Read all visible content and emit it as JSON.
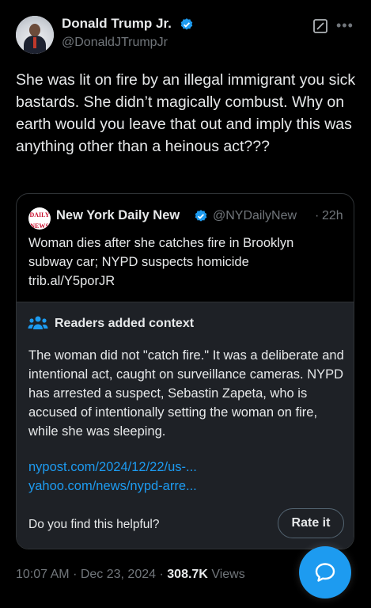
{
  "author": {
    "name": "Donald Trump Jr.",
    "handle": "@DonaldJTrumpJr",
    "verified": true
  },
  "icons": {
    "verified": "verified-badge-icon",
    "grok": "grok-icon",
    "more": "more-icon",
    "context": "people-icon",
    "reply": "reply-bubble-icon"
  },
  "colors": {
    "accent": "#1d9bf0",
    "background": "#000000",
    "context_bg": "#1e2126"
  },
  "tweet": {
    "text": "She was lit on fire by an illegal immigrant you sick bastards. She didn’t magically combust. Why on earth would you leave that out and imply this was anything other than a heinous act???"
  },
  "quote": {
    "logo_line1": "DAILY",
    "logo_line2": "NEWS",
    "name": "New York Daily New",
    "handle": "@NYDailyNew",
    "dot": "·",
    "time": "22h",
    "text_line1": "Woman dies after she catches fire in Brooklyn",
    "text_line2": "subway car; NYPD suspects homicide",
    "link": "trib.al/Y5porJR"
  },
  "context": {
    "title": "Readers added context",
    "body": "The woman did not \"catch fire.\" It was a deliberate and intentional act, caught on surveillance cameras. NYPD has arrested a suspect, Sebastin Zapeta, who is accused of intentionally setting the woman on fire, while she was sleeping.",
    "link1": "nypost.com/2024/12/22/us-...",
    "link2": "yahoo.com/news/nypd-arre...",
    "helpful_question": "Do you find this helpful?",
    "rate_label": "Rate it"
  },
  "meta": {
    "time": "10:07 AM",
    "sep1": "·",
    "date": "Dec 23, 2024",
    "sep2": "·",
    "views_count": "308.7K",
    "views_label": "Views"
  }
}
